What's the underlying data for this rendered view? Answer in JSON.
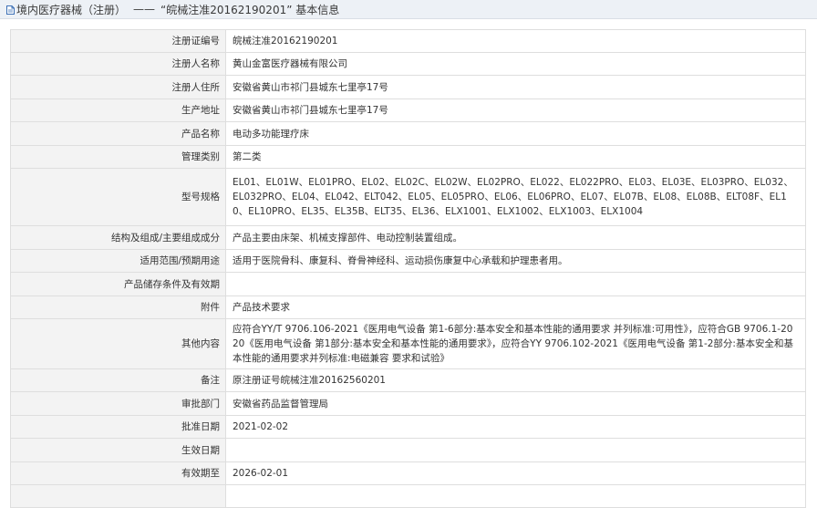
{
  "header": {
    "title_prefix": "境内医疗器械（注册）",
    "separator": "——",
    "title_main": "“皖械注准20162190201” 基本信息",
    "icon": "document-icon"
  },
  "rows": [
    {
      "label": "注册证编号",
      "value": "皖械注准20162190201"
    },
    {
      "label": "注册人名称",
      "value": "黄山金富医疗器械有限公司"
    },
    {
      "label": "注册人住所",
      "value": "安徽省黄山市祁门县城东七里亭17号"
    },
    {
      "label": "生产地址",
      "value": "安徽省黄山市祁门县城东七里亭17号"
    },
    {
      "label": "产品名称",
      "value": "电动多功能理疗床"
    },
    {
      "label": "管理类别",
      "value": "第二类"
    },
    {
      "label": "型号规格",
      "value": "EL01、EL01W、EL01PRO、EL02、EL02C、EL02W、EL02PRO、EL022、EL022PRO、EL03、EL03E、EL03PRO、EL032、EL032PRO、EL04、EL042、ELT042、EL05、EL05PRO、EL06、EL06PRO、EL07、EL07B、EL08、EL08B、ELT08F、EL10、EL10PRO、EL35、EL35B、ELT35、EL36、ELX1001、ELX1002、ELX1003、ELX1004"
    },
    {
      "label": "结构及组成/主要组成成分",
      "value": "产品主要由床架、机械支撑部件、电动控制装置组成。"
    },
    {
      "label": "适用范围/预期用途",
      "value": "适用于医院骨科、康复科、脊骨神经科、运动损伤康复中心承载和护理患者用。"
    },
    {
      "label": "产品储存条件及有效期",
      "value": ""
    },
    {
      "label": "附件",
      "value": "产品技术要求"
    },
    {
      "label": "其他内容",
      "value": "应符合YY/T 9706.106-2021《医用电气设备 第1-6部分:基本安全和基本性能的通用要求 并列标准:可用性》，应符合GB 9706.1-2020《医用电气设备 第1部分:基本安全和基本性能的通用要求》，应符合YY 9706.102-2021《医用电气设备 第1-2部分:基本安全和基本性能的通用要求并列标准:电磁兼容 要求和试验》"
    },
    {
      "label": "备注",
      "value": "原注册证号皖械注准20162560201"
    },
    {
      "label": "审批部门",
      "value": "安徽省药品监督管理局"
    },
    {
      "label": "批准日期",
      "value": "2021-02-02"
    },
    {
      "label": "生效日期",
      "value": ""
    },
    {
      "label": "有效期至",
      "value": "2026-02-01"
    },
    {
      "label": "",
      "value": ""
    }
  ]
}
